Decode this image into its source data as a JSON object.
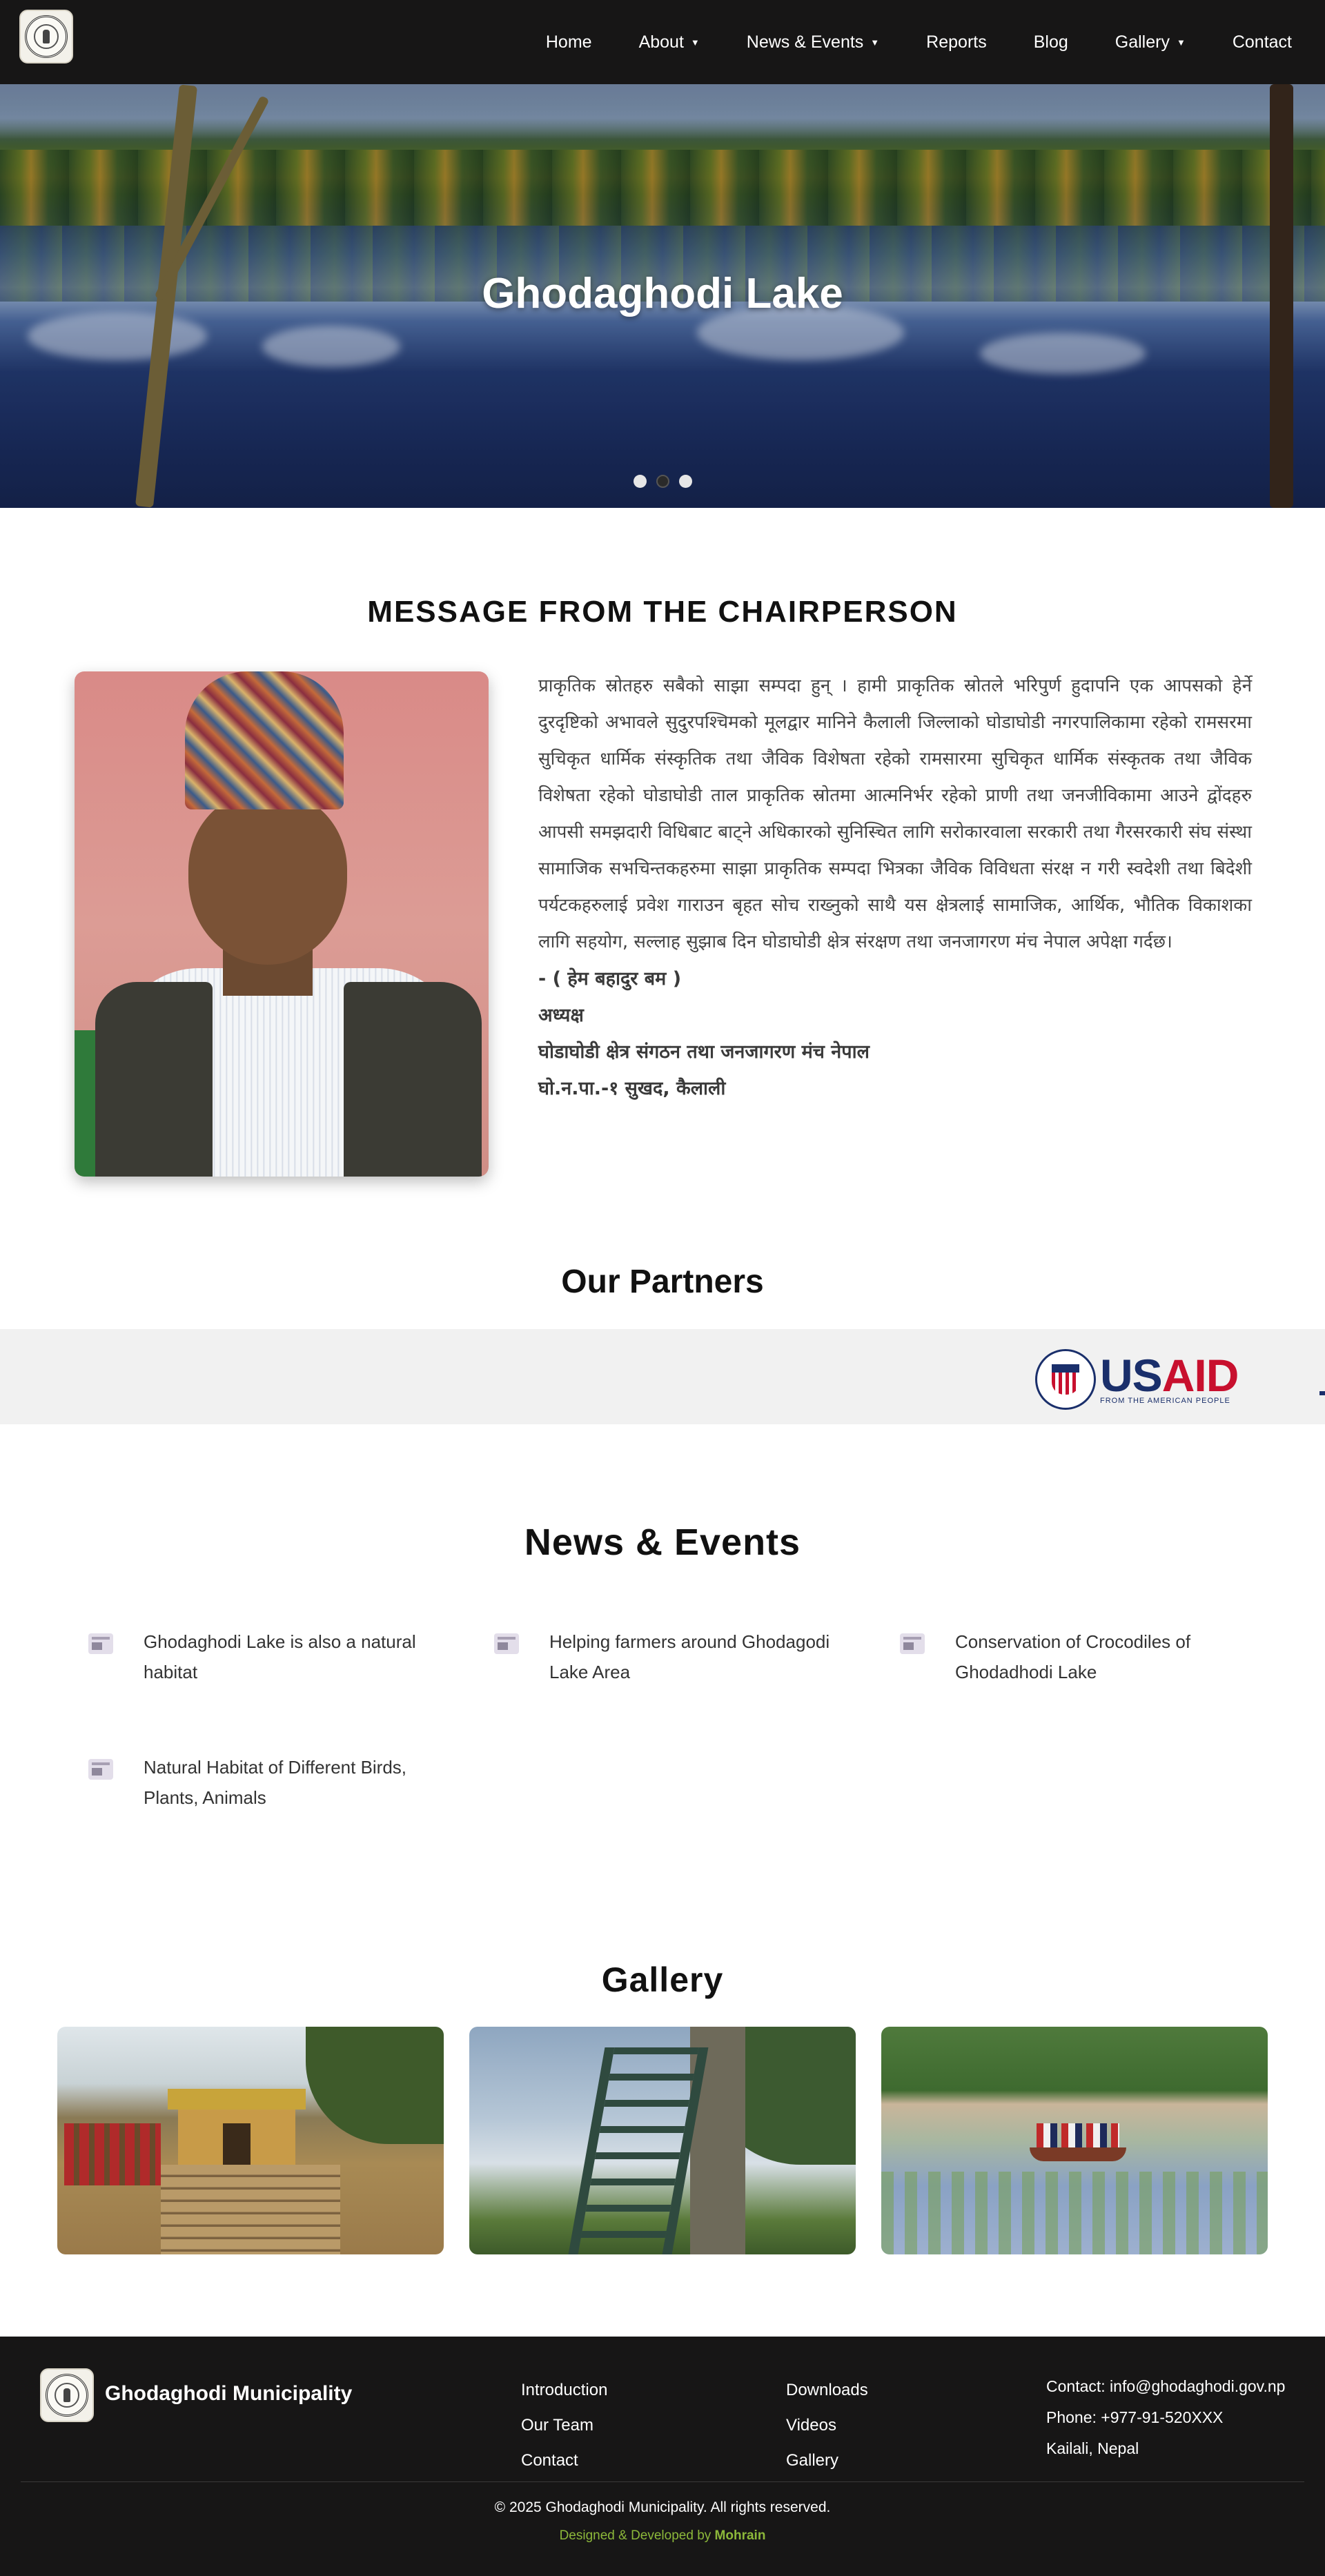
{
  "nav": {
    "logo_icon": "municipality-seal-icon",
    "items": [
      {
        "label": "Home",
        "has_dropdown": false
      },
      {
        "label": "About",
        "has_dropdown": true
      },
      {
        "label": "News & Events",
        "has_dropdown": true
      },
      {
        "label": "Reports",
        "has_dropdown": false
      },
      {
        "label": "Blog",
        "has_dropdown": false
      },
      {
        "label": "Gallery",
        "has_dropdown": true
      },
      {
        "label": "Contact",
        "has_dropdown": false
      }
    ],
    "dropdown_glyph": "▼"
  },
  "hero": {
    "title": "Ghodaghodi Lake",
    "slides_count": 3,
    "active_slide": 2
  },
  "chairperson": {
    "heading": "MESSAGE FROM THE CHAIRPERSON",
    "message": "प्राकृतिक स्रोतहरु सबैको साझा सम्पदा हुन् । हामी प्राकृतिक स्रोतले भरिपुर्ण हुदापनि एक आपसको हेर्ने दुरदृष्टिको अभावले सुदुरपश्चिमको मूलद्वार मानिने कैलाली जिल्लाको घोडाघोडी नगरपालिकामा रहेको रामसरमा सुचिकृत धार्मिक संस्कृतिक तथा जैविक विशेषता रहेको रामसारमा सुचिकृत धार्मिक संस्कृतक तथा जैविक विशेषता रहेको घोडाघोडी ताल प्राकृतिक स्रोतमा आत्मनिर्भर रहेको प्राणी तथा जनजीविकामा आउने द्वोंदहरु आपसी समझदारी विधिबाट बाट्ने अधिकारको सुनिस्चित लागि सरोकारवाला सरकारी तथा गैरसरकारी संघ संस्था सामाजिक सभचिन्तकहरुमा साझा प्राकृतिक सम्पदा भित्रका जैविक विविधता संरक्ष न गरी स्वदेशी तथा बिदेशी पर्यटकहरुलाई प्रवेश गाराउन बृहत सोच राख्नुको साथै यस क्षेत्रलाई सामाजिक, आर्थिक, भौतिक विकाशका लागि सहयोग, सल्लाह सुझाब दिन घोडाघोडी क्षेत्र संरक्षण तथा जनजागरण मंच नेपाल अपेक्षा गर्दछ।",
    "signature": [
      "- ( हेम बहादुर बम )",
      "अध्यक्ष",
      "घोडाघोडी क्षेत्र संगठन तथा जनजागरण मंच नेपाल",
      "घो.न.पा.-१ सुखद, कैलाली"
    ]
  },
  "partners": {
    "heading": "Our Partners",
    "logo": {
      "us": "US",
      "aid": "AID",
      "tagline": "FROM THE AMERICAN PEOPLE"
    }
  },
  "news": {
    "heading": "News & Events",
    "icon": "news-article-icon",
    "items": [
      "Ghodaghodi Lake is also a natural habitat",
      "Helping farmers around Ghodagodi Lake Area",
      "Conservation of Crocodiles of Ghodadhodi Lake",
      "Natural Habitat of Different Birds, Plants, Animals"
    ]
  },
  "gallery": {
    "heading": "Gallery",
    "images": [
      "temple-steps-photo",
      "watch-tower-photo",
      "lake-boat-photo"
    ]
  },
  "footer": {
    "brand": "Ghodaghodi Municipality",
    "col1": [
      "Introduction",
      "Our Team",
      "Contact"
    ],
    "col2": [
      "Downloads",
      "Videos",
      "Gallery"
    ],
    "contact": [
      "Contact: info@ghodaghodi.gov.np",
      "Phone: +977-91-520XXX",
      "Kailali, Nepal"
    ],
    "copyright": "© 2025 Ghodaghodi Municipality. All rights reserved.",
    "dev_prefix": "Designed & Developed by ",
    "dev_name": "Mohrain"
  },
  "colors": {
    "nav_bg": "#171616",
    "accent_green": "#8cb83a",
    "usaid_blue": "#1a2f6b",
    "usaid_red": "#c8102e"
  }
}
